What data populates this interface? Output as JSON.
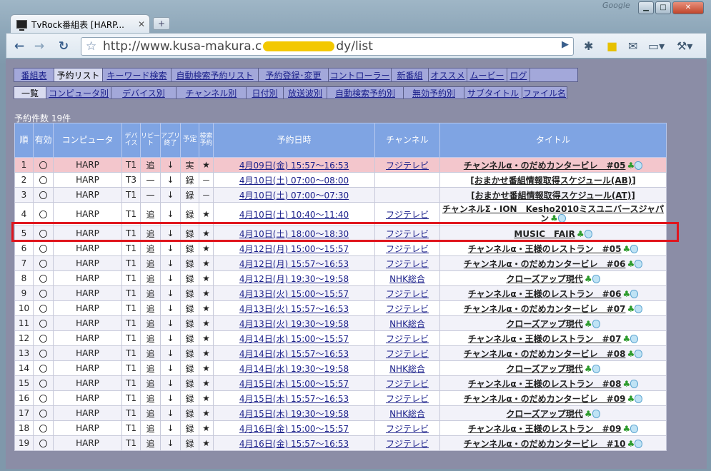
{
  "browser": {
    "tab_title": "TvRock番組表 [HARP...",
    "brand": "Google",
    "url_prefix": "http://www.kusa-makura.c",
    "url_suffix": "dy/list"
  },
  "menu_main": [
    "番組表",
    "予約リスト",
    "キーワード検索",
    "自動検索予約リスト",
    "予約登録･変更",
    "コントローラー",
    "新番組",
    "オススメ",
    "ムービー",
    "ログ"
  ],
  "menu_sub": [
    "一覧",
    "コンピュータ別",
    "デバイス別",
    "チャンネル別",
    "日付別",
    "放送波別",
    "自動検索予約別",
    "無効予約別",
    "サブタイトル",
    "ファイル名"
  ],
  "count_label": "予約件数 19件",
  "headers": {
    "num": "順",
    "enabled": "有効",
    "computer": "コンピュータ",
    "device": "デバイス",
    "repeat": "リピート",
    "app": "アプリ終了",
    "plan": "予定",
    "search": "検索予約",
    "datetime": "予約日時",
    "channel": "チャンネル",
    "title": "タイトル"
  },
  "rows": [
    [
      "1",
      "〇",
      "HARP",
      "T1",
      "追",
      "↓",
      "実",
      "★",
      "4月09日(金) 15:57〜16:53",
      "フジテレビ",
      "チャンネルα・のだめカンタービレ　#05"
    ],
    [
      "2",
      "〇",
      "HARP",
      "T3",
      "一",
      "↓",
      "録",
      "－",
      "4月10日(土) 07:00〜08:00",
      "",
      "[おまかせ番組情報取得スケジュール(AB)]"
    ],
    [
      "3",
      "〇",
      "HARP",
      "T1",
      "一",
      "↓",
      "録",
      "－",
      "4月10日(土) 07:00〜07:30",
      "",
      "[おまかせ番組情報取得スケジュール(AT)]"
    ],
    [
      "4",
      "〇",
      "HARP",
      "T1",
      "追",
      "↓",
      "録",
      "★",
      "4月10日(土) 10:40〜11:40",
      "フジテレビ",
      "チャンネルΣ・ION　Kesho2010ミスユニバースジャパン"
    ],
    [
      "5",
      "〇",
      "HARP",
      "T1",
      "追",
      "↓",
      "録",
      "★",
      "4月10日(土) 18:00〜18:30",
      "フジテレビ",
      "MUSIC　FAIR"
    ],
    [
      "6",
      "〇",
      "HARP",
      "T1",
      "追",
      "↓",
      "録",
      "★",
      "4月12日(月) 15:00〜15:57",
      "フジテレビ",
      "チャンネルα・王様のレストラン　#05"
    ],
    [
      "7",
      "〇",
      "HARP",
      "T1",
      "追",
      "↓",
      "録",
      "★",
      "4月12日(月) 15:57〜16:53",
      "フジテレビ",
      "チャンネルα・のだめカンタービレ　#06"
    ],
    [
      "8",
      "〇",
      "HARP",
      "T1",
      "追",
      "↓",
      "録",
      "★",
      "4月12日(月) 19:30〜19:58",
      "NHK総合",
      "クローズアップ現代"
    ],
    [
      "9",
      "〇",
      "HARP",
      "T1",
      "追",
      "↓",
      "録",
      "★",
      "4月13日(火) 15:00〜15:57",
      "フジテレビ",
      "チャンネルα・王様のレストラン　#06"
    ],
    [
      "10",
      "〇",
      "HARP",
      "T1",
      "追",
      "↓",
      "録",
      "★",
      "4月13日(火) 15:57〜16:53",
      "フジテレビ",
      "チャンネルα・のだめカンタービレ　#07"
    ],
    [
      "11",
      "〇",
      "HARP",
      "T1",
      "追",
      "↓",
      "録",
      "★",
      "4月13日(火) 19:30〜19:58",
      "NHK総合",
      "クローズアップ現代"
    ],
    [
      "12",
      "〇",
      "HARP",
      "T1",
      "追",
      "↓",
      "録",
      "★",
      "4月14日(水) 15:00〜15:57",
      "フジテレビ",
      "チャンネルα・王様のレストラン　#07"
    ],
    [
      "13",
      "〇",
      "HARP",
      "T1",
      "追",
      "↓",
      "録",
      "★",
      "4月14日(水) 15:57〜16:53",
      "フジテレビ",
      "チャンネルα・のだめカンタービレ　#08"
    ],
    [
      "14",
      "〇",
      "HARP",
      "T1",
      "追",
      "↓",
      "録",
      "★",
      "4月14日(水) 19:30〜19:58",
      "NHK総合",
      "クローズアップ現代"
    ],
    [
      "15",
      "〇",
      "HARP",
      "T1",
      "追",
      "↓",
      "録",
      "★",
      "4月15日(木) 15:00〜15:57",
      "フジテレビ",
      "チャンネルα・王様のレストラン　#08"
    ],
    [
      "16",
      "〇",
      "HARP",
      "T1",
      "追",
      "↓",
      "録",
      "★",
      "4月15日(木) 15:57〜16:53",
      "フジテレビ",
      "チャンネルα・のだめカンタービレ　#09"
    ],
    [
      "17",
      "〇",
      "HARP",
      "T1",
      "追",
      "↓",
      "録",
      "★",
      "4月15日(木) 19:30〜19:58",
      "NHK総合",
      "クローズアップ現代"
    ],
    [
      "18",
      "〇",
      "HARP",
      "T1",
      "追",
      "↓",
      "録",
      "★",
      "4月16日(金) 15:00〜15:57",
      "フジテレビ",
      "チャンネルα・王様のレストラン　#09"
    ],
    [
      "19",
      "〇",
      "HARP",
      "T1",
      "追",
      "↓",
      "録",
      "★",
      "4月16日(金) 15:57〜16:53",
      "フジテレビ",
      "チャンネルα・のだめカンタービレ　#10"
    ]
  ]
}
